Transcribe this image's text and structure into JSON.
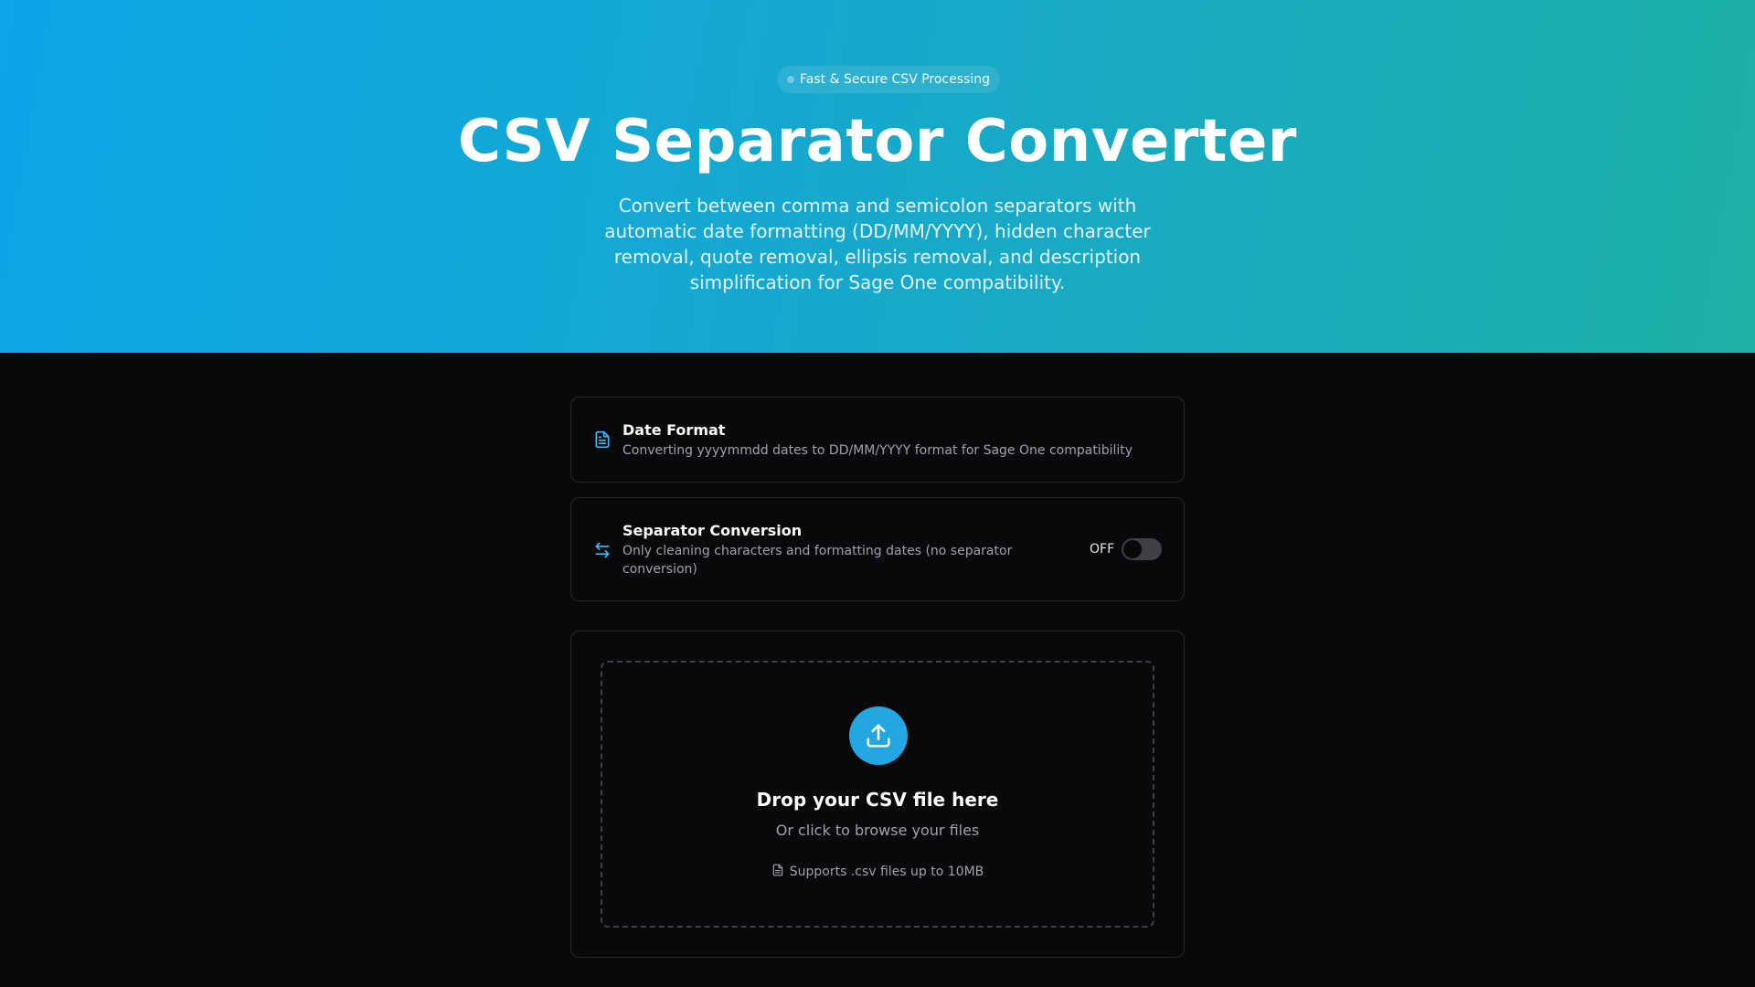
{
  "hero": {
    "badge": "Fast & Secure CSV Processing",
    "title": "CSV Separator Converter",
    "subtitle": "Convert between comma and semicolon separators with automatic date formatting (DD/MM/YYYY), hidden character removal, quote removal, ellipsis removal, and description simplification for Sage One compatibility."
  },
  "date_format": {
    "icon": "file-text-icon",
    "title": "Date Format",
    "description": "Converting yyyymmdd dates to DD/MM/YYYY format for Sage One compatibility"
  },
  "separator_conversion": {
    "icon": "arrow-left-right-icon",
    "title": "Separator Conversion",
    "description": "Only cleaning characters and formatting dates (no separator conversion)",
    "toggle_label": "OFF",
    "toggle_on": false
  },
  "upload": {
    "icon": "upload-icon",
    "title": "Drop your CSV file here",
    "subtitle": "Or click to browse your files",
    "note_icon": "file-icon",
    "note": "Supports .csv files up to 10MB"
  },
  "colors": {
    "accent": "#0ea5e9",
    "hero_gradient_end": "#1cb0a6",
    "background": "#09090b"
  }
}
